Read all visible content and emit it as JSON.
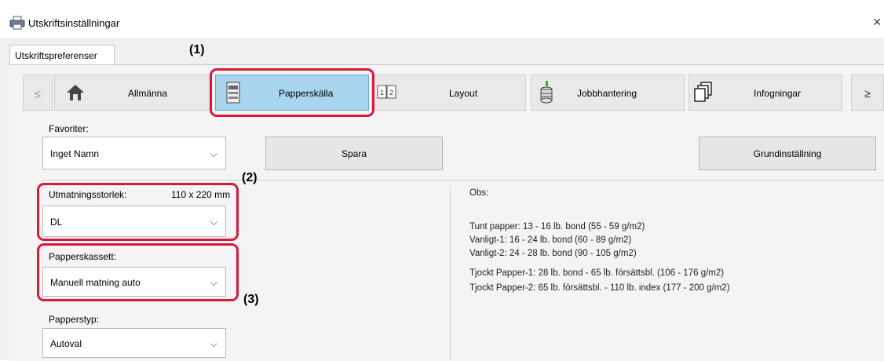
{
  "window": {
    "title": "Utskriftsinställningar",
    "close": "×"
  },
  "tab": {
    "label": "Utskriftspreferenser"
  },
  "nav": {
    "prev": "≤",
    "next": "≥",
    "items": [
      {
        "label": "Allmänna",
        "icon": "home-icon"
      },
      {
        "label": "Papperskälla",
        "icon": "paper-tray-icon",
        "selected": true
      },
      {
        "label": "Layout",
        "icon": "layout-icon"
      },
      {
        "label": "Jobbhantering",
        "icon": "job-stack-icon"
      },
      {
        "label": "Infogningar",
        "icon": "insert-pages-icon"
      }
    ]
  },
  "favorites": {
    "label": "Favoriter:",
    "value": "Inget Namn",
    "save": "Spara",
    "default": "Grundinställning"
  },
  "output_size": {
    "label": "Utmatningsstorlek:",
    "dims": "110 x 220 mm",
    "value": "DL"
  },
  "paper_tray": {
    "label": "Papperskassett:",
    "value": "Manuell matning auto"
  },
  "paper_type": {
    "label": "Papperstyp:",
    "value": "Autoval"
  },
  "notes": {
    "title": "Obs:",
    "lines": [
      "Tunt papper: 13 - 16 lb. bond (55 - 59 g/m2)",
      "Vanligt-1: 16 - 24 lb. bond (60 - 89 g/m2)",
      "Vanligt-2: 24 - 28 lb. bond (90 - 105 g/m2)",
      "Tjockt Papper-1: 28 lb. bond - 65 lb. försättsbl. (106 - 176 g/m2)",
      "Tjockt Papper-2: 65 lb. försättsbl. - 110 lb. index (177 - 200 g/m2)"
    ]
  },
  "callouts": {
    "c1": "(1)",
    "c2": "(2)",
    "c3": "(3)"
  },
  "colors": {
    "highlight": "#d8193a",
    "selected_tab": "#a9d6ee"
  }
}
